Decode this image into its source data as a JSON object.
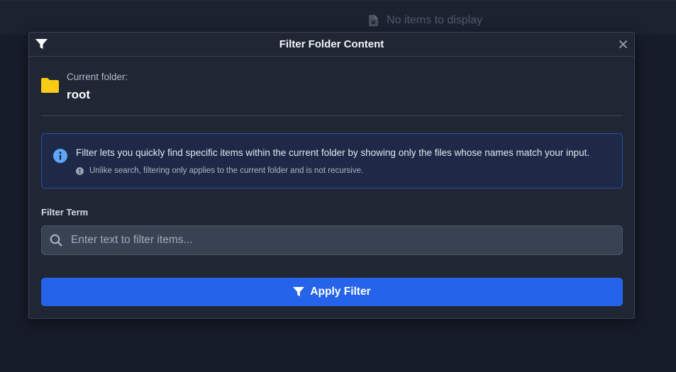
{
  "background": {
    "empty_state": "No items to display"
  },
  "modal": {
    "title": "Filter Folder Content",
    "current_folder_label": "Current folder:",
    "current_folder_name": "root",
    "info": {
      "main_text": "Filter lets you quickly find specific items within the current folder by showing only the files whose names match your input.",
      "sub_text": "Unlike search, filtering only applies to the current folder and is not recursive."
    },
    "filter_label": "Filter Term",
    "filter_placeholder": "Enter text to filter items...",
    "filter_value": "",
    "apply_label": "Apply Filter"
  },
  "colors": {
    "accent": "#2563eb",
    "folder": "#facc15",
    "info_icon": "#60a5fa",
    "info_border": "#2f4fa8"
  },
  "icons": {
    "header": "filter-icon",
    "close": "close-icon",
    "folder": "folder-icon",
    "info": "info-circle-icon",
    "note": "exclamation-circle-icon",
    "search": "search-icon",
    "apply": "filter-icon",
    "empty": "file-icon"
  }
}
